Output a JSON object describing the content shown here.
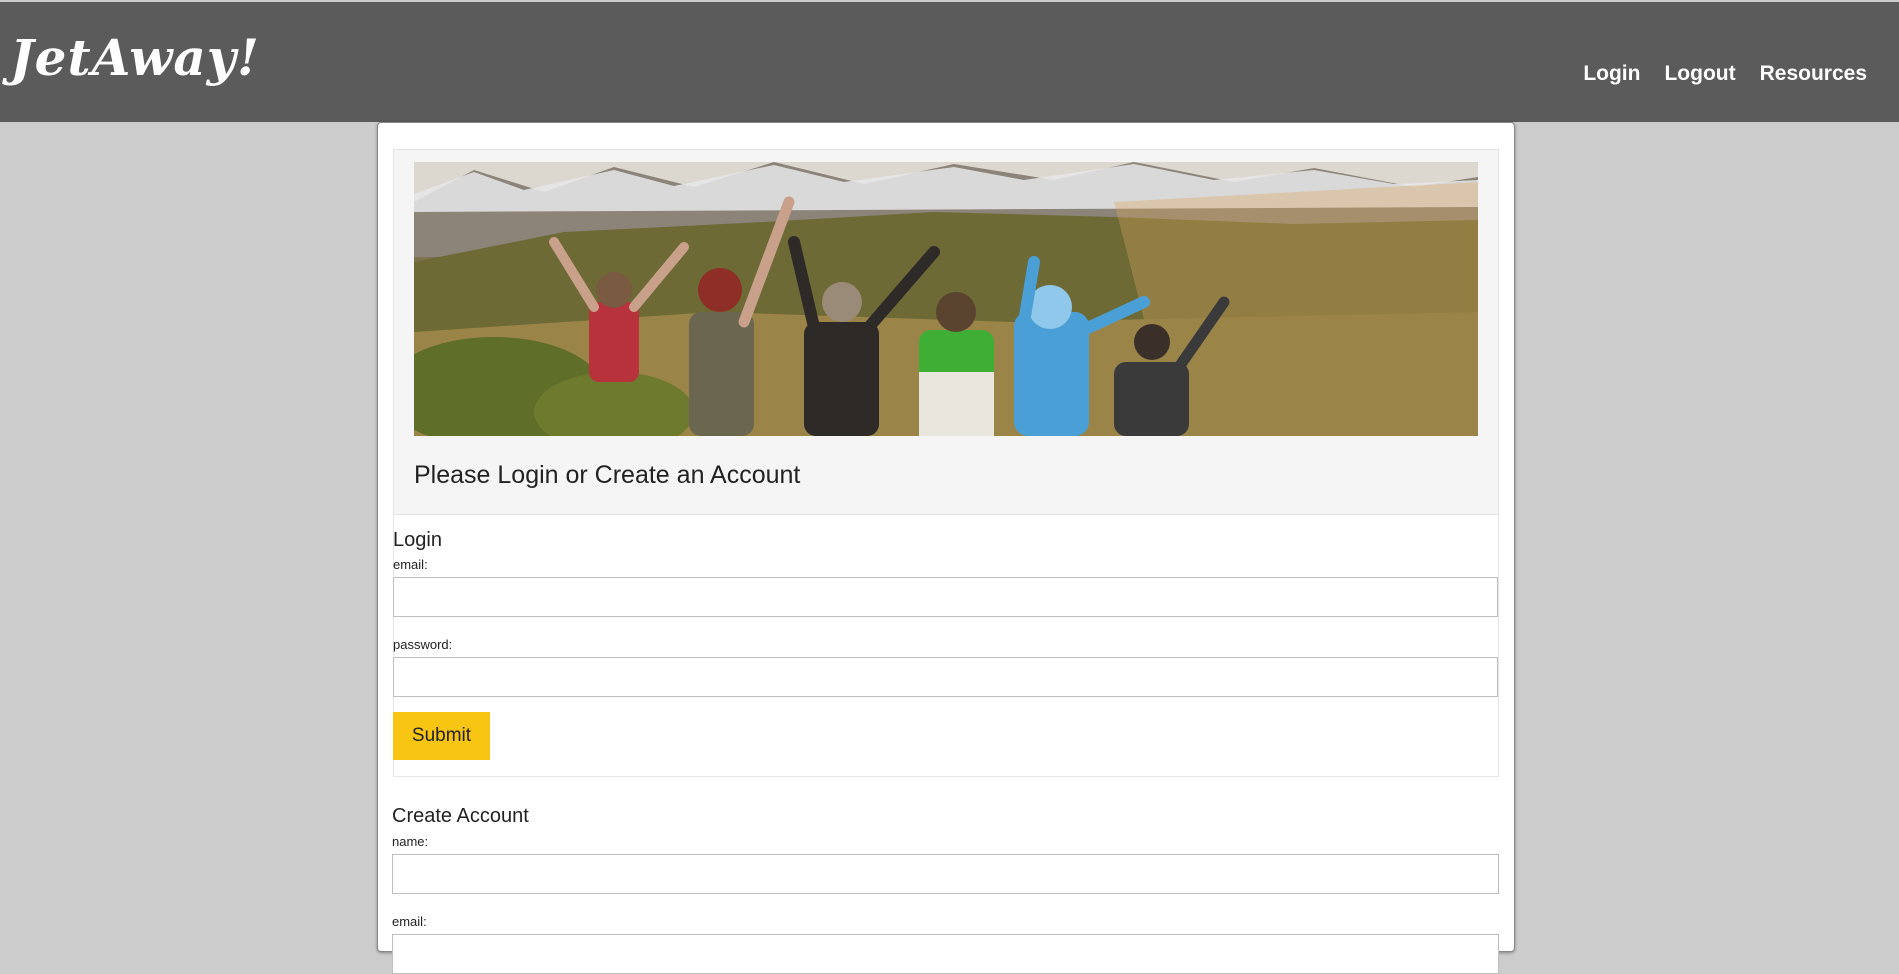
{
  "header": {
    "logo": "JetAway!",
    "nav": [
      "Login",
      "Logout",
      "Resources"
    ]
  },
  "hero": {
    "title": "Please Login or Create an Account",
    "image_alt": "group of friends cheering in front of mountains"
  },
  "login": {
    "heading": "Login",
    "email_label": "email:",
    "email_value": "",
    "password_label": "password:",
    "password_value": "",
    "submit_label": "Submit"
  },
  "create_account": {
    "heading": "Create Account",
    "name_label": "name:",
    "name_value": "",
    "email_label": "email:",
    "email_value": ""
  },
  "colors": {
    "header_bg": "#5b5b5b",
    "page_bg": "#cccccc",
    "submit_bg": "#f8c512"
  }
}
